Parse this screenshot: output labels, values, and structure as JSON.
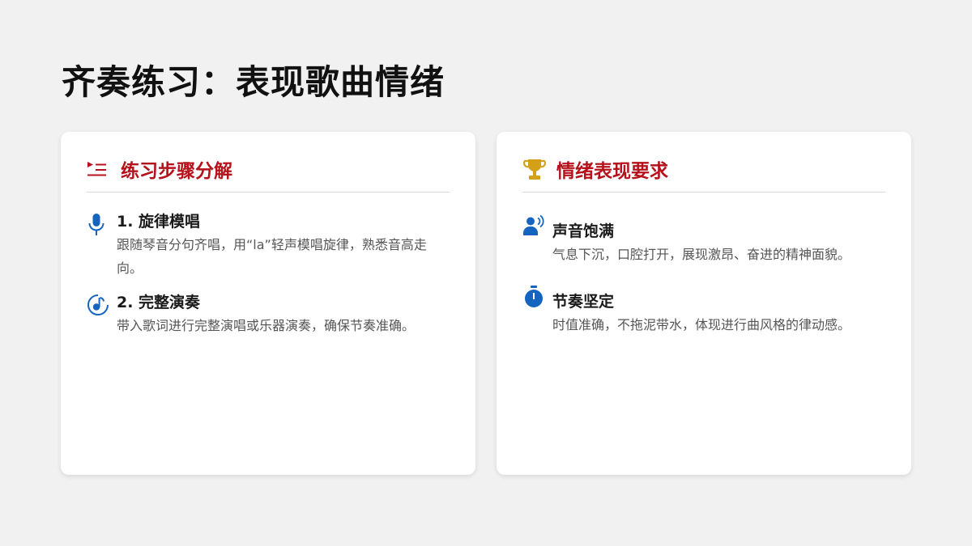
{
  "slide": {
    "title": "齐奏练习：表现歌曲情绪"
  },
  "left_card": {
    "title": "练习步骤分解",
    "icon": "list-play-icon",
    "items": [
      {
        "icon": "microphone-icon",
        "title": "1. 旋律模唱",
        "desc": "跟随琴音分句齐唱，用“la”轻声模唱旋律，熟悉音高走向。"
      },
      {
        "icon": "music-disc-icon",
        "title": "2. 完整演奏",
        "desc": "带入歌词进行完整演唱或乐器演奏，确保节奏准确。"
      }
    ]
  },
  "right_card": {
    "title": "情绪表现要求",
    "icon": "trophy-icon",
    "items": [
      {
        "icon": "person-voice-icon",
        "title": "声音饱满",
        "desc": "气息下沉，口腔打开，展现激昂、奋进的精神面貌。"
      },
      {
        "icon": "stopwatch-icon",
        "title": "节奏坚定",
        "desc": "时值准确，不拖泥带水，体现进行曲风格的律动感。"
      }
    ]
  },
  "colors": {
    "accent_red": "#b5121b",
    "icon_blue": "#1565c0",
    "trophy_gold": "#d4a017",
    "background": "#f1f1f1"
  }
}
